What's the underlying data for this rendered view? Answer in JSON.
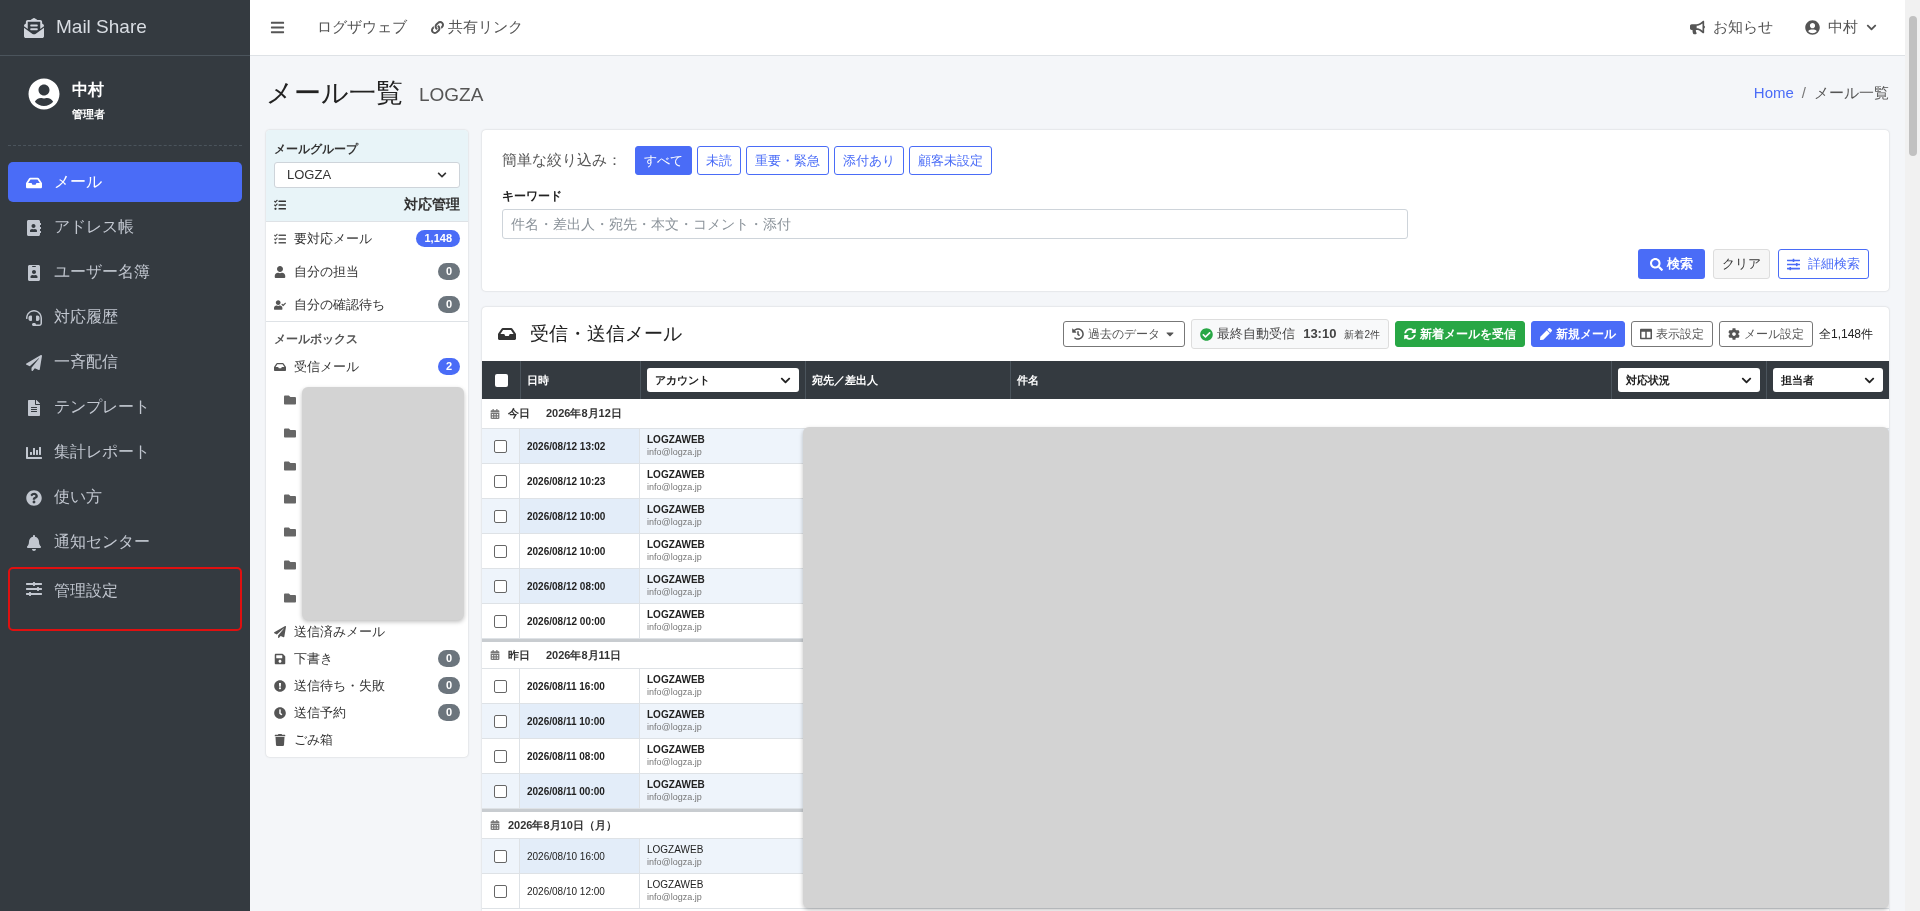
{
  "app": {
    "name": "Mail Share"
  },
  "user": {
    "name": "中村",
    "role": "管理者"
  },
  "nav": [
    {
      "label": "メール",
      "selected": true,
      "outlined": false
    },
    {
      "label": "アドレス帳",
      "selected": false,
      "outlined": false
    },
    {
      "label": "ユーザー名簿",
      "selected": false,
      "outlined": false
    },
    {
      "label": "対応履歴",
      "selected": false,
      "outlined": false
    },
    {
      "label": "一斉配信",
      "selected": false,
      "outlined": false
    },
    {
      "label": "テンプレート",
      "selected": false,
      "outlined": false
    },
    {
      "label": "集計レポート",
      "selected": false,
      "outlined": false
    },
    {
      "label": "使い方",
      "selected": false,
      "outlined": false
    },
    {
      "label": "通知センター",
      "selected": false,
      "outlined": false
    },
    {
      "label": "管理設定",
      "selected": false,
      "outlined": true
    }
  ],
  "topbar": {
    "links": [
      "ログザウェブ",
      "共有リンク"
    ],
    "notice": "お知らせ",
    "user": "中村"
  },
  "page": {
    "title": "メール一覧",
    "subtitle": "LOGZA",
    "breadcrumb": [
      "Home",
      "メール一覧"
    ],
    "breadcrumb_separator": "/"
  },
  "mail_group": {
    "label": "メールグループ",
    "value": "LOGZA",
    "section": "対応管理",
    "items": [
      {
        "label": "要対応メール",
        "count": "1,148",
        "color": "#4a6cf7"
      },
      {
        "label": "自分の担当",
        "count": "0",
        "color": "#6c757d"
      },
      {
        "label": "自分の確認待ち",
        "count": "0",
        "color": "#6c757d"
      }
    ],
    "mailbox_label": "メールボックス",
    "inbox": {
      "label": "受信メール",
      "count": "2",
      "color": "#4a6cf7"
    },
    "folders": [
      {
        "kind": "folder"
      },
      {
        "kind": "folder"
      },
      {
        "kind": "folder"
      },
      {
        "kind": "folder"
      },
      {
        "kind": "folder"
      },
      {
        "kind": "folder"
      },
      {
        "kind": "folder"
      }
    ],
    "others": [
      {
        "label": "送信済みメール"
      },
      {
        "label": "下書き",
        "count": "0",
        "color": "#6c757d"
      },
      {
        "label": "送信待ち・失敗",
        "count": "0",
        "color": "#6c757d"
      },
      {
        "label": "送信予約",
        "count": "0",
        "color": "#6c757d"
      },
      {
        "label": "ごみ箱"
      }
    ]
  },
  "filter": {
    "label": "簡単な絞り込み：",
    "chips": [
      {
        "label": "すべて",
        "selected": true
      },
      {
        "label": "未読",
        "selected": false
      },
      {
        "label": "重要・緊急",
        "selected": false
      },
      {
        "label": "添付あり",
        "selected": false
      },
      {
        "label": "顧客未設定",
        "selected": false
      }
    ],
    "keyword_label": "キーワード",
    "keyword_placeholder": "件名・差出人・宛先・本文・コメント・添付",
    "search": "検索",
    "clear": "クリア",
    "advanced": "詳細検索"
  },
  "mail_list": {
    "title": "受信・送信メール",
    "tools": {
      "past": "過去のデータ",
      "last_label": "最終自動受信",
      "last_time": "13:10",
      "new_count": "新着2件",
      "receive": "新着メールを受信",
      "compose": "新規メール",
      "display": "表示設定",
      "settings": "メール設定",
      "total": "全1,148件"
    },
    "select_all_checked": false,
    "columns": [
      {
        "label": "日時",
        "kind": "text"
      },
      {
        "label": "アカウント",
        "kind": "select"
      },
      {
        "label": "宛先／差出人",
        "kind": "text"
      },
      {
        "label": "件名",
        "kind": "text"
      },
      {
        "label": "対応状況",
        "kind": "select"
      },
      {
        "label": "担当者",
        "kind": "select"
      }
    ],
    "groups": [
      {
        "label": "今日",
        "date": "2026年8月12日",
        "rows": [
          {
            "datetime": "2026/08/12 13:02",
            "account": "LOGZAWEB",
            "email": "info@logza.jp",
            "unread": true,
            "shaded": true,
            "checked": false
          },
          {
            "datetime": "2026/08/12 10:23",
            "account": "LOGZAWEB",
            "email": "info@logza.jp",
            "unread": true,
            "shaded": false,
            "checked": false
          },
          {
            "datetime": "2026/08/12 10:00",
            "account": "LOGZAWEB",
            "email": "info@logza.jp",
            "unread": true,
            "shaded": true,
            "checked": false
          },
          {
            "datetime": "2026/08/12 10:00",
            "account": "LOGZAWEB",
            "email": "info@logza.jp",
            "unread": true,
            "shaded": false,
            "checked": false
          },
          {
            "datetime": "2026/08/12 08:00",
            "account": "LOGZAWEB",
            "email": "info@logza.jp",
            "unread": true,
            "shaded": true,
            "checked": false
          },
          {
            "datetime": "2026/08/12 00:00",
            "account": "LOGZAWEB",
            "email": "info@logza.jp",
            "unread": true,
            "shaded": false,
            "checked": false
          }
        ]
      },
      {
        "label": "昨日",
        "date": "2026年8月11日",
        "rows": [
          {
            "datetime": "2026/08/11 16:00",
            "account": "LOGZAWEB",
            "email": "info@logza.jp",
            "unread": true,
            "shaded": false,
            "checked": false
          },
          {
            "datetime": "2026/08/11 10:00",
            "account": "LOGZAWEB",
            "email": "info@logza.jp",
            "unread": true,
            "shaded": true,
            "checked": false
          },
          {
            "datetime": "2026/08/11 08:00",
            "account": "LOGZAWEB",
            "email": "info@logza.jp",
            "unread": true,
            "shaded": false,
            "checked": false
          },
          {
            "datetime": "2026/08/11 00:00",
            "account": "LOGZAWEB",
            "email": "info@logza.jp",
            "unread": true,
            "shaded": true,
            "checked": false
          }
        ]
      },
      {
        "date": "2026年8月10日（月）",
        "rows": [
          {
            "datetime": "2026/08/10 16:00",
            "account": "LOGZAWEB",
            "email": "info@logza.jp",
            "unread": false,
            "shaded": true,
            "checked": false
          },
          {
            "datetime": "2026/08/10 12:00",
            "account": "LOGZAWEB",
            "email": "info@logza.jp",
            "unread": false,
            "shaded": false,
            "checked": false
          }
        ]
      }
    ]
  }
}
